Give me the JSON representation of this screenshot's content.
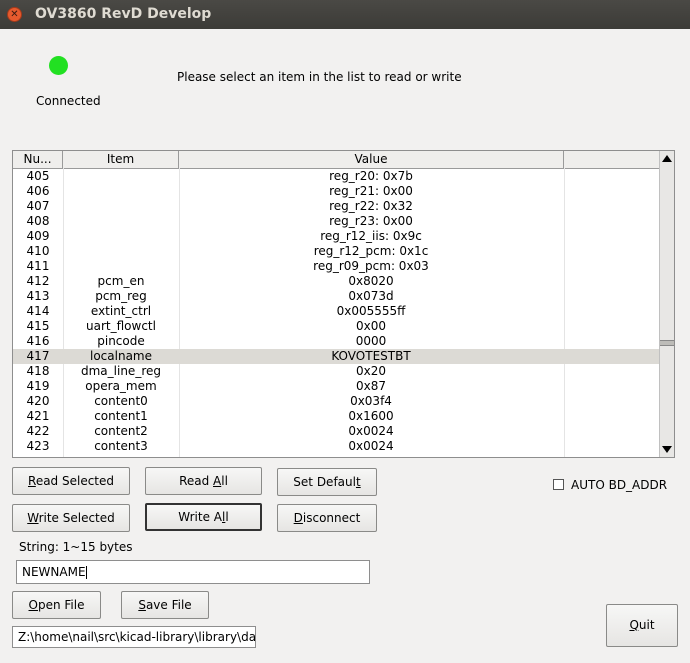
{
  "window": {
    "title": "OV3860 RevD Develop"
  },
  "status": {
    "label": "Connected",
    "led_color": "#22e022"
  },
  "prompt": "Please select an item in the list to read or write",
  "table": {
    "columns": [
      "Nu...",
      "Item",
      "Value"
    ],
    "rows": [
      {
        "num": "405",
        "item": "",
        "value": "reg_r20:  0x7b"
      },
      {
        "num": "406",
        "item": "",
        "value": "reg_r21:  0x00"
      },
      {
        "num": "407",
        "item": "",
        "value": "reg_r22:  0x32"
      },
      {
        "num": "408",
        "item": "",
        "value": "reg_r23:  0x00"
      },
      {
        "num": "409",
        "item": "",
        "value": "reg_r12_iis:  0x9c"
      },
      {
        "num": "410",
        "item": "",
        "value": "reg_r12_pcm:  0x1c"
      },
      {
        "num": "411",
        "item": "",
        "value": "reg_r09_pcm:  0x03"
      },
      {
        "num": "412",
        "item": "pcm_en",
        "value": "0x8020"
      },
      {
        "num": "413",
        "item": "pcm_reg",
        "value": "0x073d"
      },
      {
        "num": "414",
        "item": "extint_ctrl",
        "value": "0x005555ff"
      },
      {
        "num": "415",
        "item": "uart_flowctl",
        "value": "0x00"
      },
      {
        "num": "416",
        "item": "pincode",
        "value": "0000"
      },
      {
        "num": "417",
        "item": "localname",
        "value": "KOVOTESTBT",
        "selected": true
      },
      {
        "num": "418",
        "item": "dma_line_reg",
        "value": "0x20"
      },
      {
        "num": "419",
        "item": "opera_mem",
        "value": "0x87"
      },
      {
        "num": "420",
        "item": "content0",
        "value": "0x03f4"
      },
      {
        "num": "421",
        "item": "content1",
        "value": "0x1600"
      },
      {
        "num": "422",
        "item": "content2",
        "value": "0x0024"
      },
      {
        "num": "423",
        "item": "content3",
        "value": "0x0024"
      }
    ]
  },
  "buttons": {
    "read_selected": {
      "pre": "",
      "acc": "R",
      "post": "ead Selected"
    },
    "read_all": {
      "pre": "Read ",
      "acc": "A",
      "post": "ll"
    },
    "set_default": {
      "pre": "Set Defaul",
      "acc": "t",
      "post": ""
    },
    "write_selected": {
      "pre": "",
      "acc": "W",
      "post": "rite Selected"
    },
    "write_all": {
      "pre": "Write A",
      "acc": "l",
      "post": "l"
    },
    "disconnect": {
      "pre": "",
      "acc": "D",
      "post": "isconnect"
    },
    "open_file": {
      "pre": "",
      "acc": "O",
      "post": "pen File"
    },
    "save_file": {
      "pre": "",
      "acc": "S",
      "post": "ave File"
    },
    "quit": {
      "pre": "",
      "acc": "Q",
      "post": "uit"
    }
  },
  "auto_bd_addr": {
    "label": "AUTO BD_ADDR",
    "checked": false
  },
  "string_hint": "String: 1~15 bytes",
  "value_input": {
    "value": "NEWNAME"
  },
  "path_input": {
    "value": "Z:\\home\\nail\\src\\kicad-library\\library\\datas"
  }
}
